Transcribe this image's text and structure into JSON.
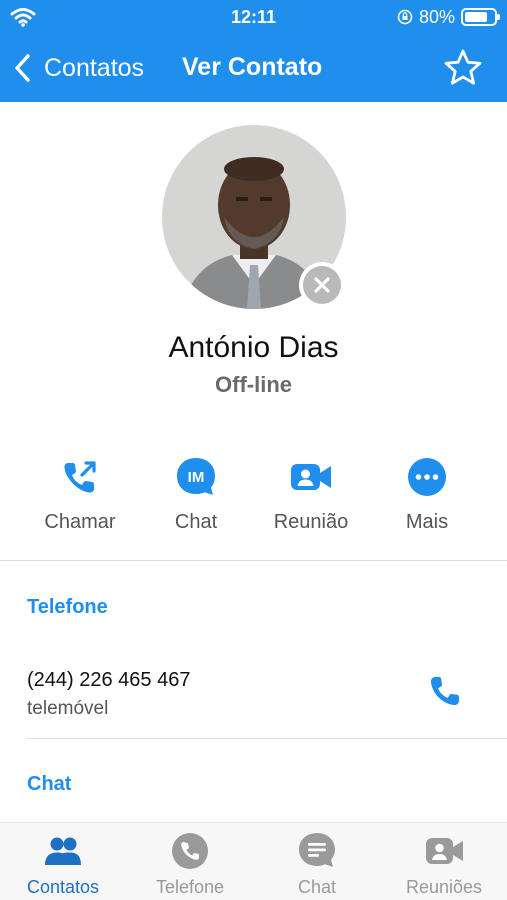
{
  "status_bar": {
    "time": "12:11",
    "battery": "80%",
    "battery_level": 0.8
  },
  "header": {
    "back_label": "Contatos",
    "title": "Ver Contato"
  },
  "contact": {
    "name": "António Dias",
    "presence": "Off-line"
  },
  "actions": [
    {
      "label": "Chamar",
      "icon": "call-out-icon"
    },
    {
      "label": "Chat",
      "icon": "im-icon"
    },
    {
      "label": "Reunião",
      "icon": "video-meeting-icon"
    },
    {
      "label": "Mais",
      "icon": "more-icon"
    }
  ],
  "phone_section": {
    "title": "Telefone",
    "number": "(244) 226 465 467",
    "type": "telemóvel"
  },
  "chat_section": {
    "title": "Chat"
  },
  "tabs": [
    {
      "label": "Contatos",
      "icon": "contacts-icon",
      "active": true
    },
    {
      "label": "Telefone",
      "icon": "phone-icon",
      "active": false
    },
    {
      "label": "Chat",
      "icon": "chat-icon",
      "active": false
    },
    {
      "label": "Reuniões",
      "icon": "meetings-icon",
      "active": false
    }
  ],
  "colors": {
    "accent": "#1f8eed",
    "tab_active": "#1f6fc2",
    "tab_inactive": "#9a9a9a",
    "offline_badge": "#b9b9b9"
  }
}
